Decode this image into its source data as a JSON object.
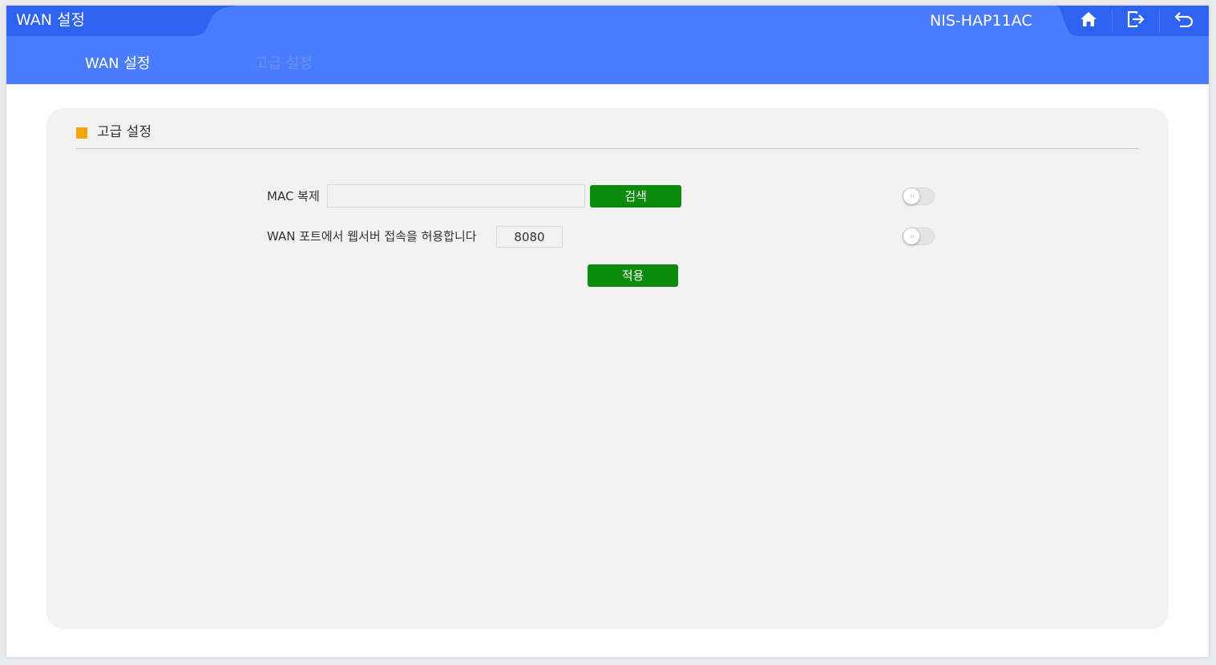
{
  "header": {
    "app_title": "WAN 설정",
    "device_name": "NIS-HAP11AC",
    "buttons": [
      {
        "icon": "home-icon"
      },
      {
        "icon": "logout-icon"
      },
      {
        "icon": "back-icon"
      }
    ]
  },
  "nav": {
    "tabs": [
      {
        "label": "WAN 설정",
        "active": true
      },
      {
        "label": "고급 설정",
        "active": false
      }
    ]
  },
  "section": {
    "title": "고급 설정",
    "marker_color": "#f7a30c"
  },
  "form": {
    "mac_clone": {
      "label": "MAC 복제",
      "value": "",
      "search_label": "검색",
      "toggle_on": false
    },
    "web_access": {
      "label": "WAN 포트에서 웹서버 접속을 허용합니다",
      "port_value": "8080",
      "toggle_on": false
    },
    "apply_label": "적용"
  },
  "colors": {
    "header_bg": "#4a7cff",
    "title_tab_bg": "#2d63f0",
    "button_green": "#0c8a0c",
    "panel_bg": "#f2f2f2"
  }
}
